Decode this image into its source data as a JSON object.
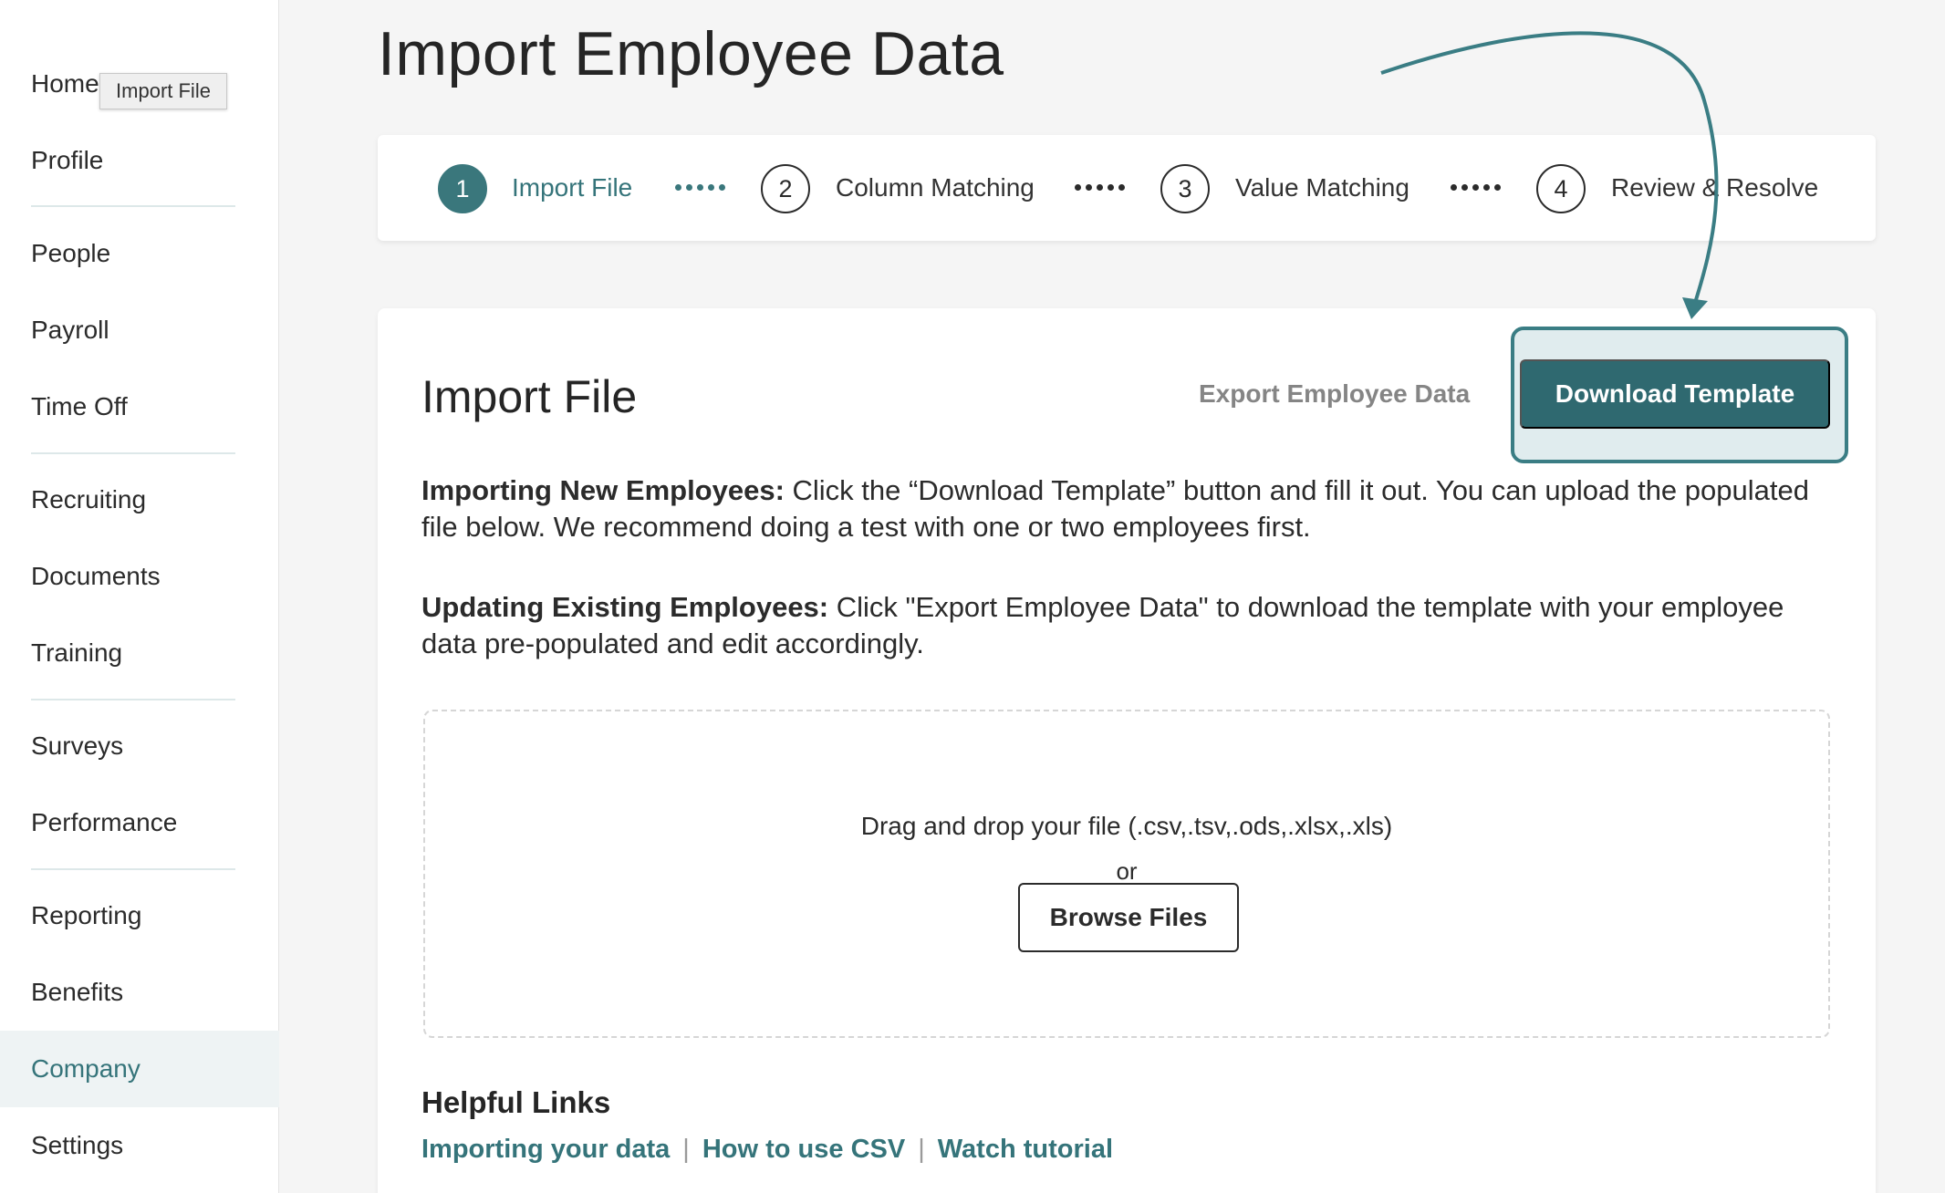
{
  "sidebar": {
    "items": [
      {
        "label": "Home"
      },
      {
        "label": "Profile"
      },
      {
        "label": "People"
      },
      {
        "label": "Payroll"
      },
      {
        "label": "Time Off"
      },
      {
        "label": "Recruiting"
      },
      {
        "label": "Documents"
      },
      {
        "label": "Training"
      },
      {
        "label": "Surveys"
      },
      {
        "label": "Performance"
      },
      {
        "label": "Reporting"
      },
      {
        "label": "Benefits"
      },
      {
        "label": "Company"
      },
      {
        "label": "Settings"
      }
    ],
    "active": "Company",
    "tooltip": "Import File"
  },
  "page": {
    "title": "Import Employee Data"
  },
  "stepper": {
    "steps": [
      {
        "number": "1",
        "label": "Import File",
        "active": true
      },
      {
        "number": "2",
        "label": "Column Matching",
        "active": false
      },
      {
        "number": "3",
        "label": "Value Matching",
        "active": false
      },
      {
        "number": "4",
        "label": "Review & Resolve",
        "active": false
      }
    ]
  },
  "card": {
    "title": "Import File",
    "export_label": "Export Employee Data",
    "download_label": "Download Template",
    "new_employees": {
      "heading": "Importing New Employees:",
      "text": " Click the “Download Template” button and fill it out. You can upload the populated file below. We recommend doing a test with one or two employees first."
    },
    "existing_employees": {
      "heading": "Updating Existing Employees:",
      "text": " Click \"Export Employee Data\" to download the template with your employee data pre-populated and edit accordingly."
    },
    "dropzone": {
      "text": "Drag and drop your file (.csv,.tsv,.ods,.xlsx,.xls)",
      "or": "or",
      "browse_label": "Browse Files"
    },
    "helpful": {
      "title": "Helpful Links",
      "links": [
        "Importing your data",
        "How to use CSV",
        "Watch tutorial"
      ],
      "separator": "|"
    }
  },
  "colors": {
    "accent": "#3a777c",
    "button": "#2f6970",
    "highlight": "#e0ecee"
  }
}
